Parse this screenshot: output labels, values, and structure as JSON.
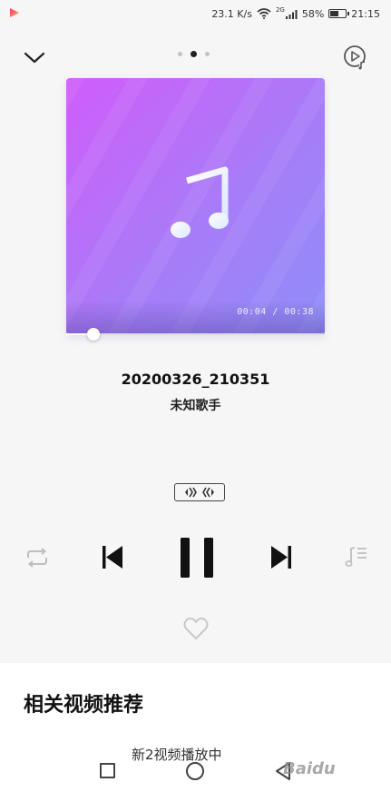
{
  "status_bar": {
    "network_speed": "23.1 K/s",
    "signal_label": "2G",
    "battery_percent": "58%",
    "battery_level": 0.58,
    "time": "21:15"
  },
  "top_bar": {
    "page_count": 3,
    "active_page": 2
  },
  "player": {
    "elapsed": "00:04",
    "separator": "/",
    "duration": "00:38",
    "progress": 0.105,
    "song_title": "20200326_210351",
    "artist": "未知歌手"
  },
  "controls": {
    "play_state": "playing",
    "favorited": false
  },
  "recommend": {
    "title": "相关视频推荐",
    "partial_item": "新2视频播放中"
  },
  "watermark": {
    "text": "Baidu"
  },
  "colors": {
    "album_start": "#d05dfa",
    "album_end": "#8e8ef8",
    "accent": "#111111",
    "app_logo_pink": "#f6318c",
    "app_logo_orange": "#fbb33b"
  }
}
